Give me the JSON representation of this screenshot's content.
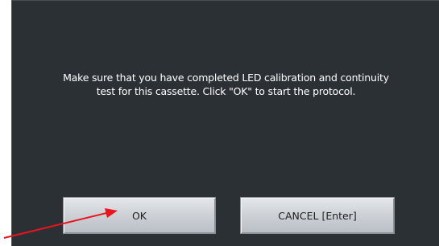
{
  "dialog": {
    "message_line1": "Make sure that you have completed LED calibration and continuity",
    "message_line2": "test for this cassette. Click \"OK\" to start the protocol."
  },
  "buttons": {
    "ok_label": "OK",
    "cancel_label": "CANCEL [Enter]"
  },
  "colors": {
    "dialog_background": "#2b3035",
    "message_text": "#ffffff",
    "annotation_arrow": "#e8141e"
  },
  "annotation": {
    "shape": "arrow",
    "points_to": "ok-button"
  }
}
